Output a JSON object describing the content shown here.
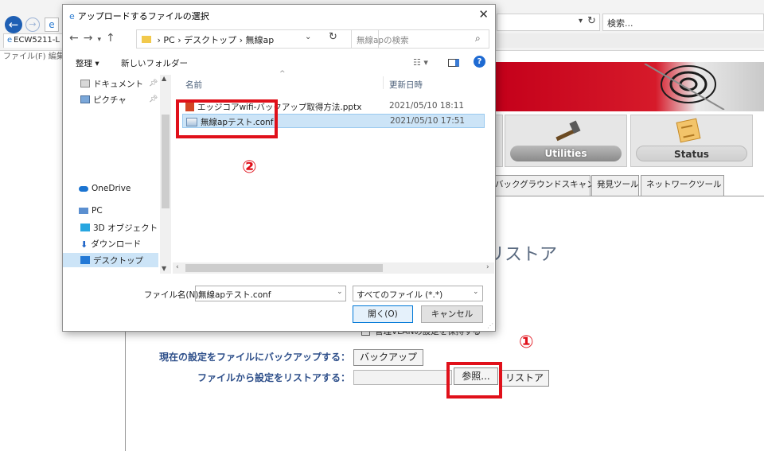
{
  "browser": {
    "back_icon": "back-arrow-icon",
    "tab_title": "ECW5211-L",
    "menu": "ファイル(F)  編集",
    "search_placeholder": "検索..."
  },
  "router_page": {
    "menu_cards": [
      {
        "label": "Utilities",
        "icon": "hammer-icon"
      },
      {
        "label": "Status",
        "icon": "notepad-icon"
      }
    ],
    "subtabs": [
      "バックグラウンドスキャン",
      "発見ツール",
      "ネットワークツール"
    ],
    "heading_fragment": "リストア",
    "keep_vlan_label": "管理VLANの設定を保持する",
    "backup_label": "現在の設定をファイルにバックアップする：",
    "backup_button": "バックアップ",
    "restore_label": "ファイルから設定をリストアする：",
    "browse_button": "参照...",
    "restore_button": "リストア"
  },
  "annotations": {
    "step1": "①",
    "step2": "②"
  },
  "dialog": {
    "title": "アップロードするファイルの選択",
    "close_icon": "close-icon",
    "path": [
      "PC",
      "デスクトップ",
      "無線ap"
    ],
    "search_placeholder": "無線apの検索",
    "toolbar": {
      "organize": "整理 ▾",
      "new_folder": "新しいフォルダー"
    },
    "nav_items": [
      {
        "label": "ドキュメント",
        "pinned": true,
        "icon": "documents-icon"
      },
      {
        "label": "ピクチャ",
        "pinned": true,
        "icon": "pictures-icon"
      },
      {
        "label": "OneDrive",
        "pinned": false,
        "icon": "onedrive-icon"
      },
      {
        "label": "PC",
        "pinned": false,
        "icon": "pc-icon"
      },
      {
        "label": "3D オブジェクト",
        "pinned": false,
        "icon": "3d-objects-icon"
      },
      {
        "label": "ダウンロード",
        "pinned": false,
        "icon": "download-icon"
      },
      {
        "label": "デスクトップ",
        "pinned": false,
        "icon": "desktop-icon",
        "selected": true
      }
    ],
    "columns": {
      "name": "名前",
      "date": "更新日時"
    },
    "files": [
      {
        "name": "エッジコアwifi-バックアップ取得方法.pptx",
        "date": "2021/05/10 18:11",
        "icon": "pptx-icon"
      },
      {
        "name": "無線apテスト.conf",
        "date": "2021/05/10 17:51",
        "icon": "conf-file-icon",
        "selected": true
      }
    ],
    "filename_label": "ファイル名(N):",
    "filename_value": "無線apテスト.conf",
    "filetype_value": "すべてのファイル (*.*)",
    "open_button": "開く(O)",
    "cancel_button": "キャンセル"
  },
  "colors": {
    "callout_red": "#e0101a",
    "selection_blue": "#cce4f7",
    "label_blue": "#2e4f8a"
  }
}
